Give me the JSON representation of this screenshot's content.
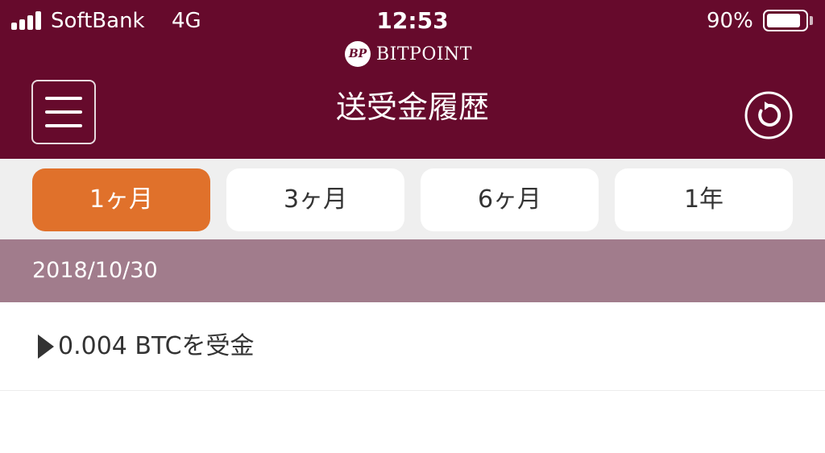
{
  "status_bar": {
    "carrier": "SoftBank",
    "network": "4G",
    "time": "12:53",
    "battery_percent_text": "90%",
    "battery_level": 0.9
  },
  "header": {
    "logo_mark": "BP",
    "logo_text": "BITPOINT",
    "title": "送受金履歴",
    "menu_icon": "hamburger-menu-icon",
    "refresh_icon": "refresh-icon",
    "background_color": "#660a2c"
  },
  "tabs": [
    {
      "label": "1ヶ月",
      "active": true
    },
    {
      "label": "3ヶ月",
      "active": false
    },
    {
      "label": "6ヶ月",
      "active": false
    },
    {
      "label": "1年",
      "active": false
    }
  ],
  "active_tab_color": "#e0712b",
  "history": {
    "date": "2018/10/30",
    "items": [
      {
        "icon": "play-triangle-icon",
        "text": "0.004 BTCを受金"
      }
    ]
  }
}
